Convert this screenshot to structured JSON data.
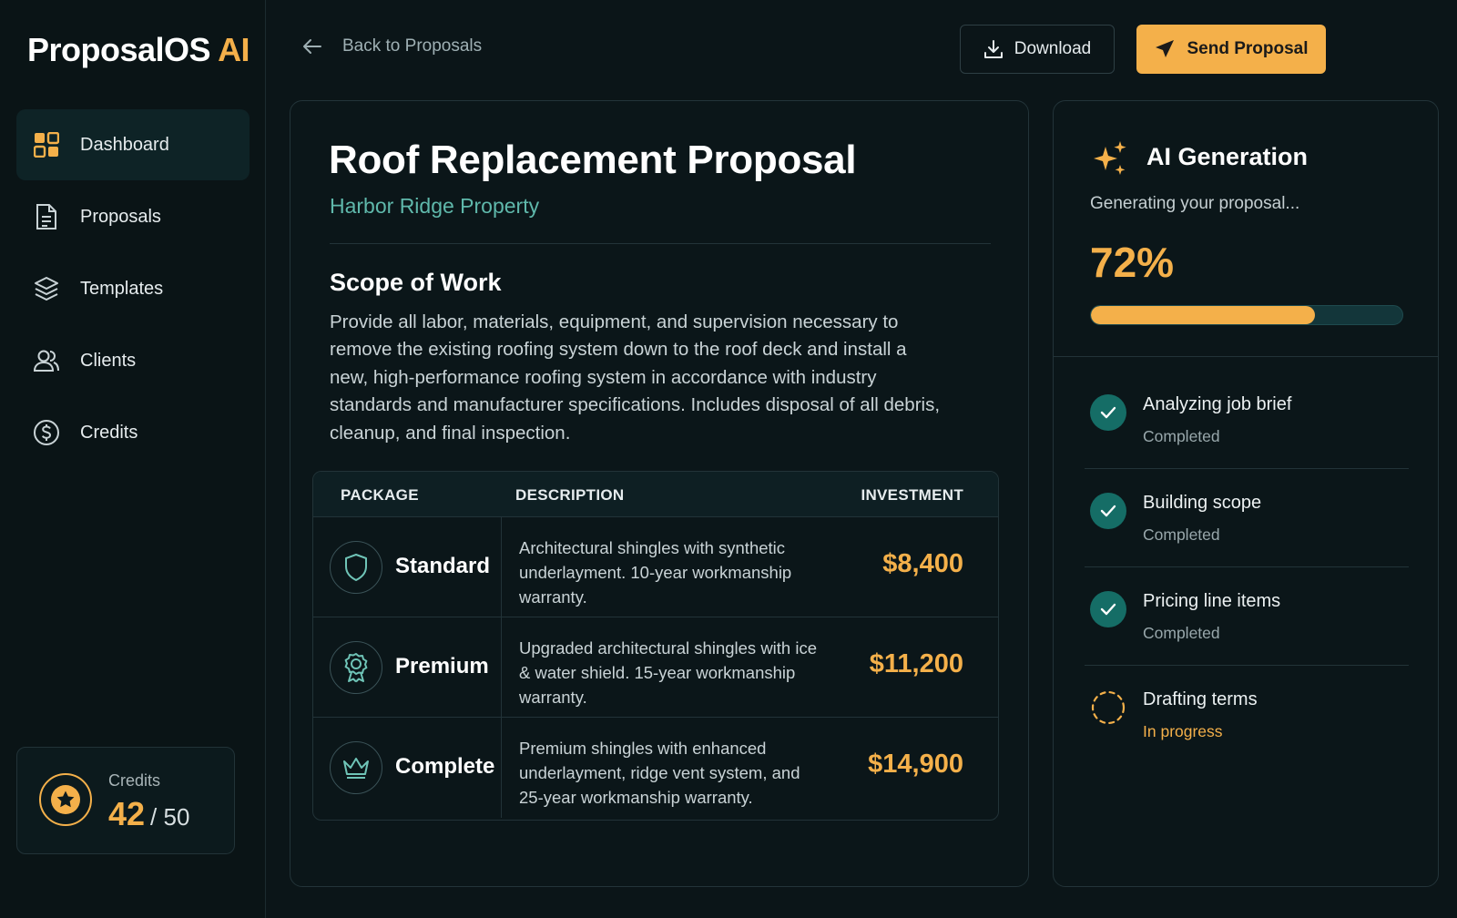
{
  "brand": {
    "name": "ProposalOS",
    "suffix": "AI"
  },
  "sidebar": {
    "items": [
      {
        "label": "Dashboard",
        "icon": "grid-icon",
        "active": true
      },
      {
        "label": "Proposals",
        "icon": "document-icon",
        "active": false
      },
      {
        "label": "Templates",
        "icon": "layers-icon",
        "active": false
      },
      {
        "label": "Clients",
        "icon": "users-icon",
        "active": false
      },
      {
        "label": "Credits",
        "icon": "dollar-circle-icon",
        "active": false
      }
    ],
    "credits": {
      "label": "Credits",
      "used": "42",
      "total": "/ 50",
      "icon": "star-coin-icon"
    }
  },
  "topbar": {
    "back_label": "Back to Proposals",
    "download_label": "Download",
    "send_label": "Send Proposal"
  },
  "proposal": {
    "title": "Roof Replacement Proposal",
    "property": "Harbor Ridge Property",
    "scope_heading": "Scope of Work",
    "scope_text": "Provide all labor, materials, equipment, and supervision necessary to remove the existing roofing system down to the roof deck and install a new, high-performance roofing system in accordance with industry standards and manufacturer specifications. Includes disposal of all debris, cleanup, and final inspection.",
    "table": {
      "headers": {
        "package": "PACKAGE",
        "description": "DESCRIPTION",
        "investment": "INVESTMENT"
      },
      "rows": [
        {
          "name": "Standard",
          "icon": "shield-icon",
          "description": "Architectural shingles with synthetic underlayment. 10-year workmanship warranty.",
          "price": "$8,400"
        },
        {
          "name": "Premium",
          "icon": "award-ribbon-icon",
          "description": "Upgraded architectural shingles with ice & water shield. 15-year workmanship warranty.",
          "price": "$11,200"
        },
        {
          "name": "Complete",
          "icon": "crown-icon",
          "description": "Premium shingles with enhanced underlayment, ridge vent system, and 25-year workmanship warranty.",
          "price": "$14,900"
        }
      ]
    }
  },
  "ai_generation": {
    "title": "AI Generation",
    "status": "Generating your proposal...",
    "percent_label": "72%",
    "progress": 0.72,
    "steps": [
      {
        "title": "Analyzing job brief",
        "status": "Completed",
        "state": "done"
      },
      {
        "title": "Building scope",
        "status": "Completed",
        "state": "done"
      },
      {
        "title": "Pricing line items",
        "status": "Completed",
        "state": "done"
      },
      {
        "title": "Drafting terms",
        "status": "In progress",
        "state": "in-progress"
      }
    ]
  },
  "colors": {
    "accent": "#f4b04a",
    "teal": "#5fb8ab",
    "check": "#156d66",
    "background": "#0b1518"
  }
}
